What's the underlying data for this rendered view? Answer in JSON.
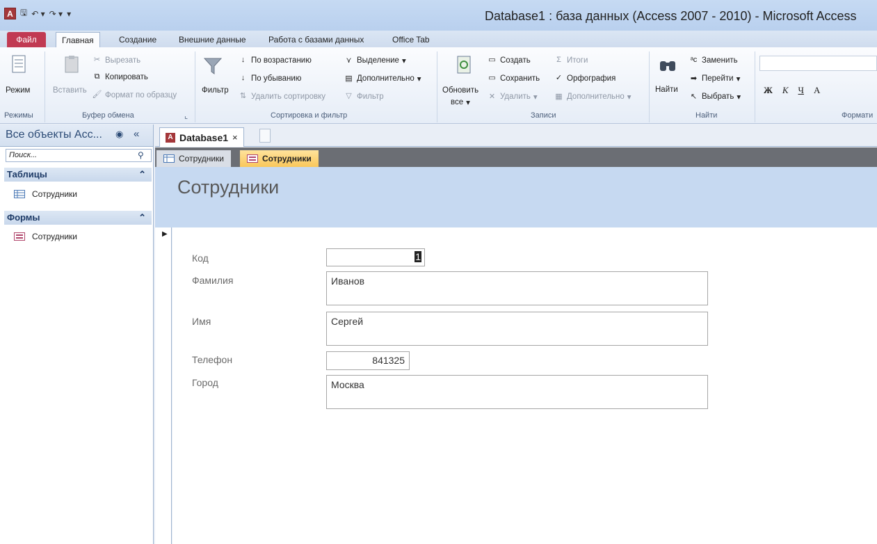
{
  "window": {
    "title": "Database1 : база данных (Access 2007 - 2010)  -  Microsoft Access"
  },
  "qat": {
    "save": "🖫",
    "undo": "↶ ▾",
    "redo": "↷ ▾",
    "customize": "▾"
  },
  "ribbon_tabs": [
    "Файл",
    "Главная",
    "Создание",
    "Внешние данные",
    "Работа с базами данных",
    "Office Tab"
  ],
  "ribbon": {
    "views": {
      "mode": "Режим",
      "group": "Режимы"
    },
    "clipboard": {
      "paste": "Вставить",
      "cut": "Вырезать",
      "copy": "Копировать",
      "format_painter": "Формат по образцу",
      "group": "Буфер обмена"
    },
    "sort_filter": {
      "filter": "Фильтр",
      "ascending": "По возрастанию",
      "descending": "По убыванию",
      "remove_sort": "Удалить сортировку",
      "selection": "Выделение",
      "advanced": "Дополнительно",
      "toggle_filter": "Фильтр",
      "group": "Сортировка и фильтр"
    },
    "records": {
      "refresh": "Обновить",
      "refresh_all": "все",
      "new": "Создать",
      "save": "Сохранить",
      "delete": "Удалить",
      "totals": "Итоги",
      "spelling": "Орфография",
      "more": "Дополнительно",
      "group": "Записи"
    },
    "find": {
      "find": "Найти",
      "replace": "Заменить",
      "goto": "Перейти",
      "select": "Выбрать",
      "group": "Найти"
    },
    "format": {
      "bold": "Ж",
      "italic": "К",
      "underline": "Ч",
      "font_color": "А",
      "group": "Формати"
    }
  },
  "nav": {
    "header": "Все объекты Acc...",
    "search_placeholder": "Поиск...",
    "groups": [
      {
        "label": "Таблицы",
        "items": [
          "Сотрудники"
        ]
      },
      {
        "label": "Формы",
        "items": [
          "Сотрудники"
        ]
      }
    ]
  },
  "doc_tab": {
    "label": "Database1",
    "close": "×"
  },
  "object_tabs": [
    "Сотрудники",
    "Сотрудники"
  ],
  "form": {
    "title": "Сотрудники",
    "fields": [
      {
        "label": "Код",
        "value": "1"
      },
      {
        "label": "Фамилия",
        "value": "Иванов"
      },
      {
        "label": "Имя",
        "value": "Сергей"
      },
      {
        "label": "Телефон",
        "value": "841325"
      },
      {
        "label": "Город",
        "value": "Москва"
      }
    ]
  }
}
